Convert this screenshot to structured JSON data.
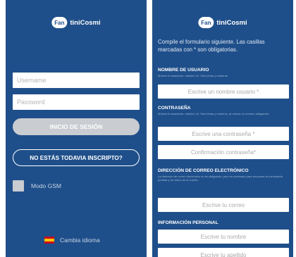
{
  "brand": {
    "mark": "Fan",
    "word": "tiniCosmi"
  },
  "login": {
    "username_placeholder": "Username",
    "password_placeholder": "Password",
    "login_button": "INICIO DE SESIÓN",
    "register_button": "NO ESTÁS TODAVIA INSCRIPTO?",
    "gsm_label": "Modo GSM",
    "gsm_checked": false,
    "language_label": "Cambia idioma"
  },
  "register": {
    "intro": "Compile el formulario siguiente. Las casillas marcadas con * son obligatorias.",
    "username_header": "NOMBRE DE USUARIO",
    "username_hint": "Mínimo 6 caracteres, máximo 10. Solo letras y números.",
    "username_placeholder": "Escrive un nombre usuario *",
    "password_header": "CONTRASEÑA",
    "password_hint": "Mínimo 6 caracteres, máximo 10. Solo letras y números, al menos un número obligatorio.",
    "password_placeholder": "Escrive una contraseña *",
    "confirm_placeholder": "Confirmación contraseña*",
    "email_header": "DIRECCIÓN DE CORREO ELECTRÓNICO",
    "email_hint": "La dirección de correo electrónico no es obligatoria, pero es necesaria para recuperar la contraseña perdida y los datos de la cuenta.",
    "email_placeholder": "Escrive tu correo",
    "personal_header": "INFORMACIÓN PERSONAL",
    "name_placeholder": "Escrive tu nombre",
    "surname_placeholder": "Escrive tu apellido"
  },
  "colors": {
    "background": "#1f4f8a",
    "button_disabled": "#c9ccd1"
  }
}
